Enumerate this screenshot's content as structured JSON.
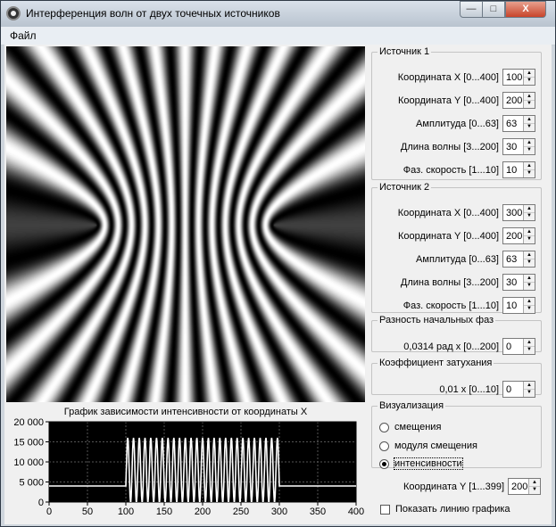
{
  "window": {
    "title": "Интерференция волн от двух точечных источников"
  },
  "title_buttons": {
    "minimize": "—",
    "maximize": "□",
    "close": "X"
  },
  "menu": {
    "file": "Файл"
  },
  "source1": {
    "legend": "Источник 1",
    "fields": [
      {
        "label": "Координата X [0...400]",
        "value": "100"
      },
      {
        "label": "Координата Y [0...400]",
        "value": "200"
      },
      {
        "label": "Амплитуда [0...63]",
        "value": "63"
      },
      {
        "label": "Длина волны [3...200]",
        "value": "30"
      },
      {
        "label": "Фаз. скорость [1...10]",
        "value": "10"
      }
    ]
  },
  "source2": {
    "legend": "Источник 2",
    "fields": [
      {
        "label": "Координата X [0...400]",
        "value": "300"
      },
      {
        "label": "Координата Y [0...400]",
        "value": "200"
      },
      {
        "label": "Амплитуда [0...63]",
        "value": "63"
      },
      {
        "label": "Длина волны [3...200]",
        "value": "30"
      },
      {
        "label": "Фаз. скорость [1...10]",
        "value": "10"
      }
    ]
  },
  "phase_diff": {
    "legend": "Разность начальных фаз",
    "label": "0,0314 рад  x  [0...200]",
    "value": "0"
  },
  "damping": {
    "legend": "Коэффициент затухания",
    "label": "0,01  x  [0...10]",
    "value": "0"
  },
  "visualization": {
    "legend": "Визуализация",
    "options": [
      "смещения",
      "модуля смещения",
      "интенсивности"
    ],
    "selected_index": 2
  },
  "coord_y": {
    "label": "Координата Y [1...399]",
    "value": "200"
  },
  "show_line": {
    "label": "Показать линию графика",
    "checked": false
  },
  "graph": {
    "title": "График зависимости интенсивности от координаты X",
    "x_ticks": [
      "0",
      "50",
      "100",
      "150",
      "200",
      "250",
      "300",
      "350",
      "400"
    ],
    "y_ticks": [
      "0",
      "5 000",
      "10 000",
      "15 000",
      "20 000"
    ]
  },
  "chart_data": {
    "type": "line",
    "title": "График зависимости интенсивности от координаты X",
    "xlim": [
      0,
      400
    ],
    "ylim": [
      0,
      20000
    ],
    "baseline": 4000,
    "peak": 16000,
    "active_range": [
      100,
      300
    ],
    "wavelength": 15,
    "grid": true,
    "series": [
      {
        "values": []
      }
    ]
  },
  "colors": {
    "plot_bg": "#000000",
    "plot_line": "#ffffff",
    "grid": "#555555"
  }
}
